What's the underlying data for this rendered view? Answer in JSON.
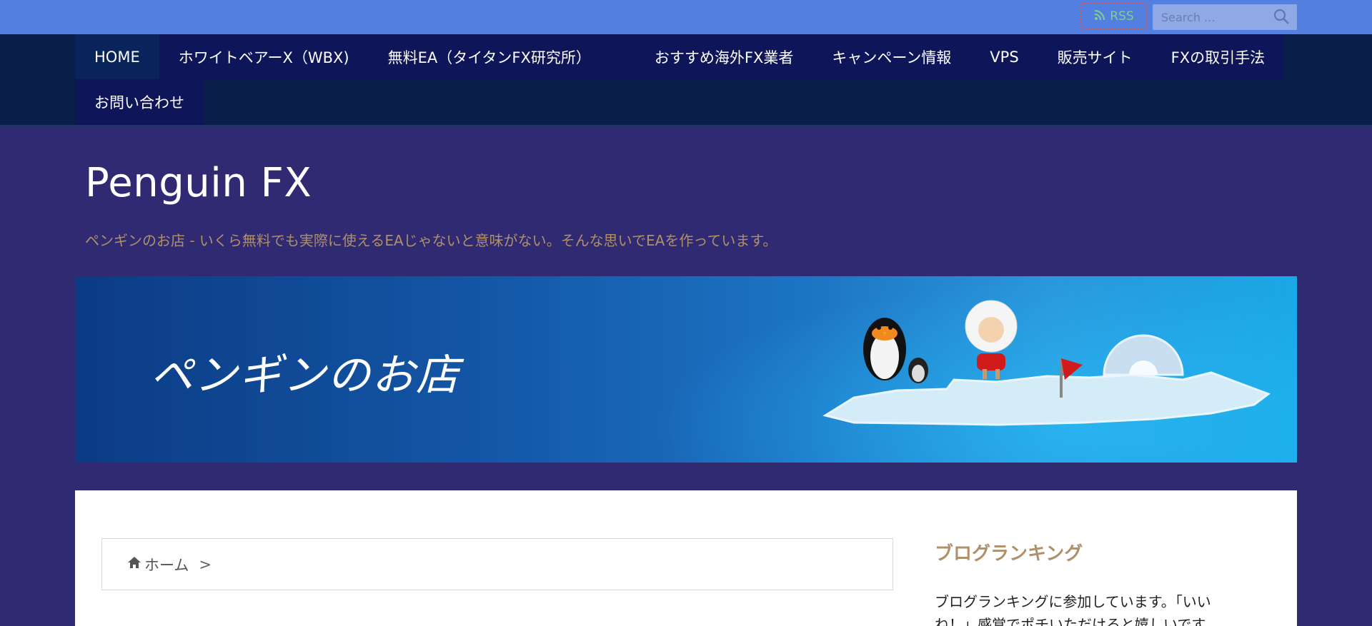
{
  "topbar": {
    "rss_label": "RSS",
    "search_placeholder": "Search ..."
  },
  "nav": {
    "items": [
      {
        "label": "HOME"
      },
      {
        "label": "ホワイトベアーX（WBX)"
      },
      {
        "label": "無料EA（タイタンFX研究所）"
      },
      {
        "label": "おすすめ海外FX業者"
      },
      {
        "label": "キャンペーン情報"
      },
      {
        "label": "VPS"
      },
      {
        "label": "販売サイト"
      },
      {
        "label": "FXの取引手法"
      },
      {
        "label": "お問い合わせ"
      }
    ]
  },
  "header": {
    "title": "Penguin FX",
    "tagline": "ペンギンのお店 - いくら無料でも実際に使えるEAじゃないと意味がない。そんな思いでEAを作っています。"
  },
  "banner": {
    "logo_text": "ペンギンのお店"
  },
  "breadcrumb": {
    "home_label": "ホーム",
    "separator": ">"
  },
  "sidebar": {
    "title": "ブログランキング",
    "text": "ブログランキングに参加しています。「いいね！」感覚でポチいただけると嬉しいです。"
  },
  "colors": {
    "topbar": "#527fe0",
    "nav": "#0a1e4a",
    "nav_item": "#0e1559",
    "page_bg": "#2f2a72",
    "accent_gold": "#b0906a",
    "rss_green": "#7ed08a"
  }
}
